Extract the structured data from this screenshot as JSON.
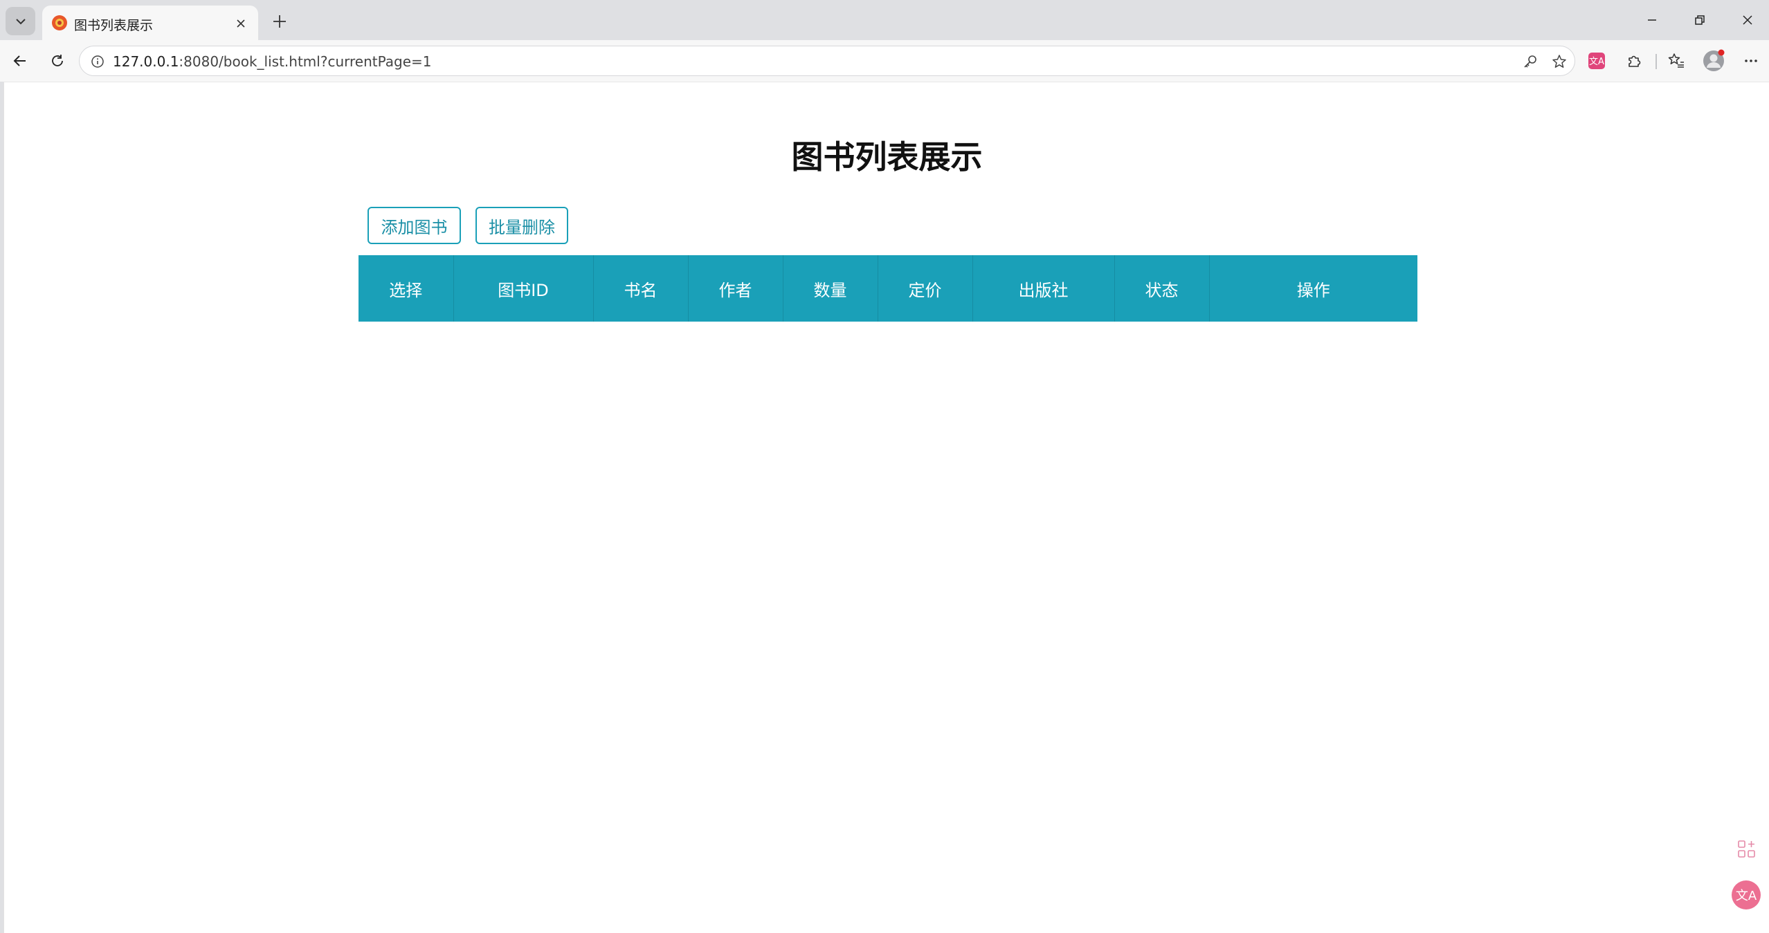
{
  "browser": {
    "tab": {
      "title": "图书列表展示",
      "favicon": "gear-favicon-icon"
    },
    "address": {
      "host": "127.0.0.1",
      "rest": ":8080/book_list.html?currentPage=1"
    },
    "icons": [
      "tab-list-icon",
      "close-icon",
      "plus-icon",
      "minimize-icon",
      "restore-icon",
      "window-close-icon",
      "back-icon",
      "reload-icon",
      "site-info-icon",
      "key-icon",
      "star-icon",
      "translate-extension-icon",
      "extensions-icon",
      "favorites-icon",
      "profile-icon",
      "more-icon"
    ]
  },
  "page": {
    "title": "图书列表展示",
    "buttons": {
      "add": "添加图书",
      "batch_delete": "批量删除"
    },
    "table": {
      "headers": [
        "选择",
        "图书ID",
        "书名",
        "作者",
        "数量",
        "定价",
        "出版社",
        "状态",
        "操作"
      ],
      "rows": []
    }
  },
  "colors": {
    "accent": "#1aa0b8",
    "button_text": "#1a8fa6",
    "translate_badge": "#e0457b"
  }
}
